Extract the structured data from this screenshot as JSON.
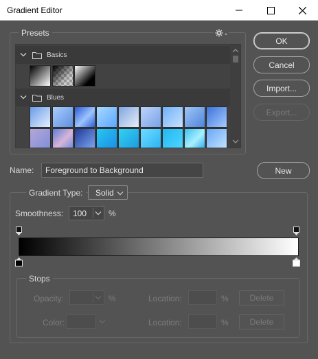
{
  "window": {
    "title": "Gradient Editor",
    "minimize_icon": "minimize-icon",
    "maximize_icon": "maximize-icon",
    "close_icon": "close-icon"
  },
  "presets": {
    "label": "Presets",
    "settings_icon": "gear-icon",
    "folders": [
      {
        "name": "Basics",
        "expanded": true
      },
      {
        "name": "Blues",
        "expanded": true
      }
    ]
  },
  "buttons": {
    "ok": "OK",
    "cancel": "Cancel",
    "import": "Import...",
    "export": "Export...",
    "new": "New"
  },
  "name": {
    "label": "Name:",
    "value": "Foreground to Background"
  },
  "gradient": {
    "type_label": "Gradient Type:",
    "type_value": "Solid",
    "smoothness_label": "Smoothness:",
    "smoothness_value": "100",
    "smoothness_unit": "%",
    "colors": {
      "start": "#000000",
      "end": "#ffffff"
    }
  },
  "stops": {
    "label": "Stops",
    "opacity_label": "Opacity:",
    "opacity_unit": "%",
    "location_label": "Location:",
    "location_unit": "%",
    "color_label": "Color:",
    "delete_label": "Delete"
  }
}
